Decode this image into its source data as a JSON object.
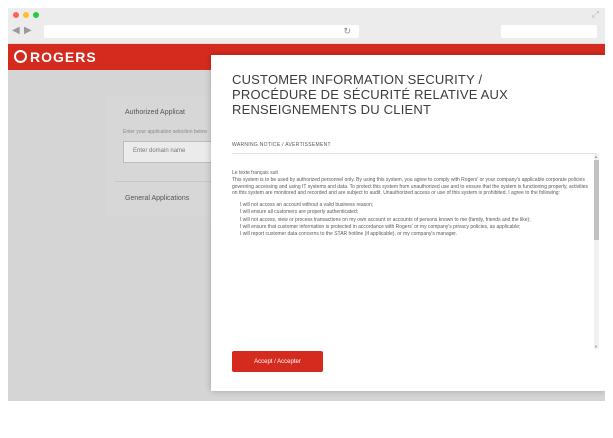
{
  "browser": {
    "url": "",
    "reload_icon": "reload-icon",
    "back_icon": "chevron-left-icon",
    "forward_icon": "chevron-right-icon"
  },
  "header": {
    "logo_text": "ROGERS",
    "brand_color": "#d52b1e"
  },
  "login_card": {
    "title": "Authorized Applicat",
    "subtitle": "Enter your application selection below",
    "input_placeholder": "Enter domain name",
    "general_link": "General Applications"
  },
  "modal": {
    "title": "CUSTOMER INFORMATION SECURITY / PROCÉDURE DE SÉCURITÉ RELATIVE AUX RENSEIGNEMENTS DU CLIENT",
    "warning_label": "WARNING NOTICE / AVERTISSEMENT",
    "greeting": "Le texte français suit",
    "intro": "This system is to be used by authorized personnel only. By using this system, you agree to comply with Rogers' or your company's applicable corporate policies governing accessing and using IT systems and data. To protect this system from unauthorized use and to ensure that the system is functioning properly, activities on this system are monitored and recorded and are subject to audit. Unauthorized access or use of this system is prohibited. I agree to the following:",
    "bullets": [
      "I will not access an account without a valid business reason;",
      "I will ensure all customers are properly authenticated;",
      "I will not access, view or process transactions on my own account or accounts of persons known to me (family, friends and the like);",
      "I will ensure that customer information is protected in accordance with Rogers' or my company's privacy policies, as applicable;",
      "I will report customer data concerns to the STAR hotline (if applicable), or my company's manager."
    ],
    "accept_label": "Accept / Accepter"
  }
}
